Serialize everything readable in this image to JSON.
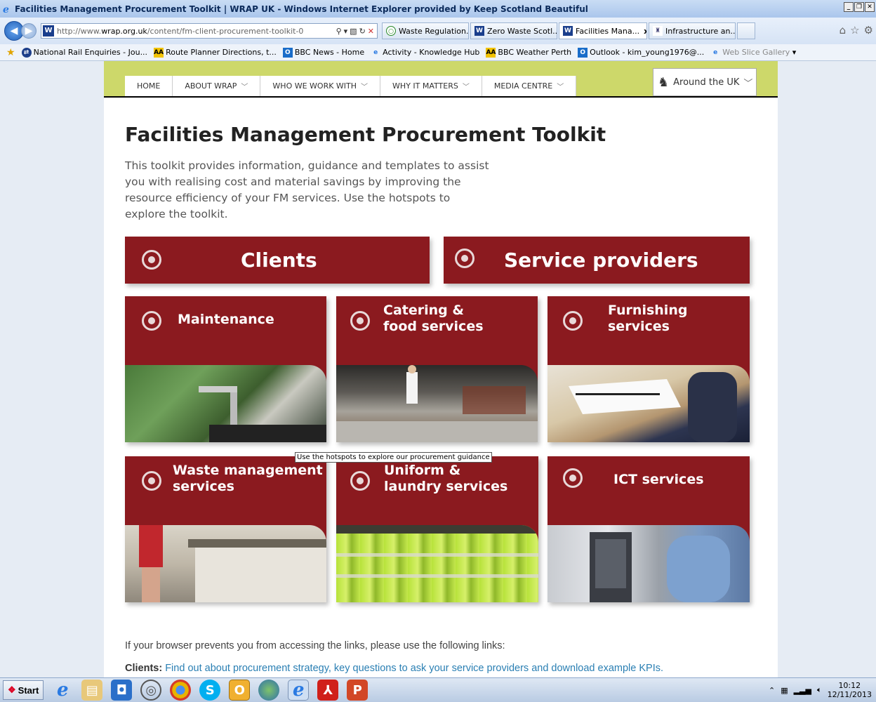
{
  "window": {
    "title": "Facilities Management Procurement Toolkit | WRAP UK - Windows Internet Explorer provided by Keep Scotland Beautiful"
  },
  "address": {
    "prefix": "http://www.",
    "domain": "wrap.org.uk",
    "path": "/content/fm-client-procurement-toolkit-0"
  },
  "tabs": [
    {
      "label": "Waste Regulation..."
    },
    {
      "label": "Zero Waste Scotl..."
    },
    {
      "label": "Facilities Mana...",
      "close": "x"
    },
    {
      "label": "Infrastructure an..."
    }
  ],
  "favorites": [
    {
      "label": "National Rail Enquiries - Jou..."
    },
    {
      "label": "Route Planner Directions, t..."
    },
    {
      "label": "BBC News - Home"
    },
    {
      "label": "Activity - Knowledge Hub"
    },
    {
      "label": "BBC Weather Perth"
    },
    {
      "label": "Outlook - kim_young1976@..."
    },
    {
      "label": "Web Slice Gallery"
    }
  ],
  "site": {
    "menu": [
      "HOME",
      "ABOUT WRAP",
      "WHO WE WORK WITH",
      "WHY IT MATTERS",
      "MEDIA CENTRE"
    ],
    "around": "Around the UK",
    "title": "Facilities Management Procurement Toolkit",
    "intro": "This toolkit provides information, guidance and templates to assist you with realising cost and material savings by improving the resource efficiency of your FM services. Use the hotspots to explore the toolkit.",
    "big_tiles": [
      "Clients",
      "Service providers"
    ],
    "tiles_row1": [
      {
        "line1": "Maintenance",
        "line2": ""
      },
      {
        "line1": "Catering &",
        "line2": "food services"
      },
      {
        "line1": "Furnishing",
        "line2": "services"
      }
    ],
    "tiles_row2": [
      {
        "line1": "Waste management",
        "line2": "services"
      },
      {
        "line1": "Uniform &",
        "line2": "laundry services"
      },
      {
        "line1": "ICT services",
        "line2": ""
      }
    ],
    "tooltip": "Use the hotspots to explore our procurement guidance",
    "footer_note": "If your browser prevents you from accessing the links, please use the following links:",
    "footer_clients_label": "Clients:",
    "footer_clients_link": "Find out about procurement strategy, key questions to ask your service providers and download example KPIs."
  },
  "taskbar": {
    "start": "Start",
    "time": "10:12",
    "date": "12/11/2013"
  }
}
